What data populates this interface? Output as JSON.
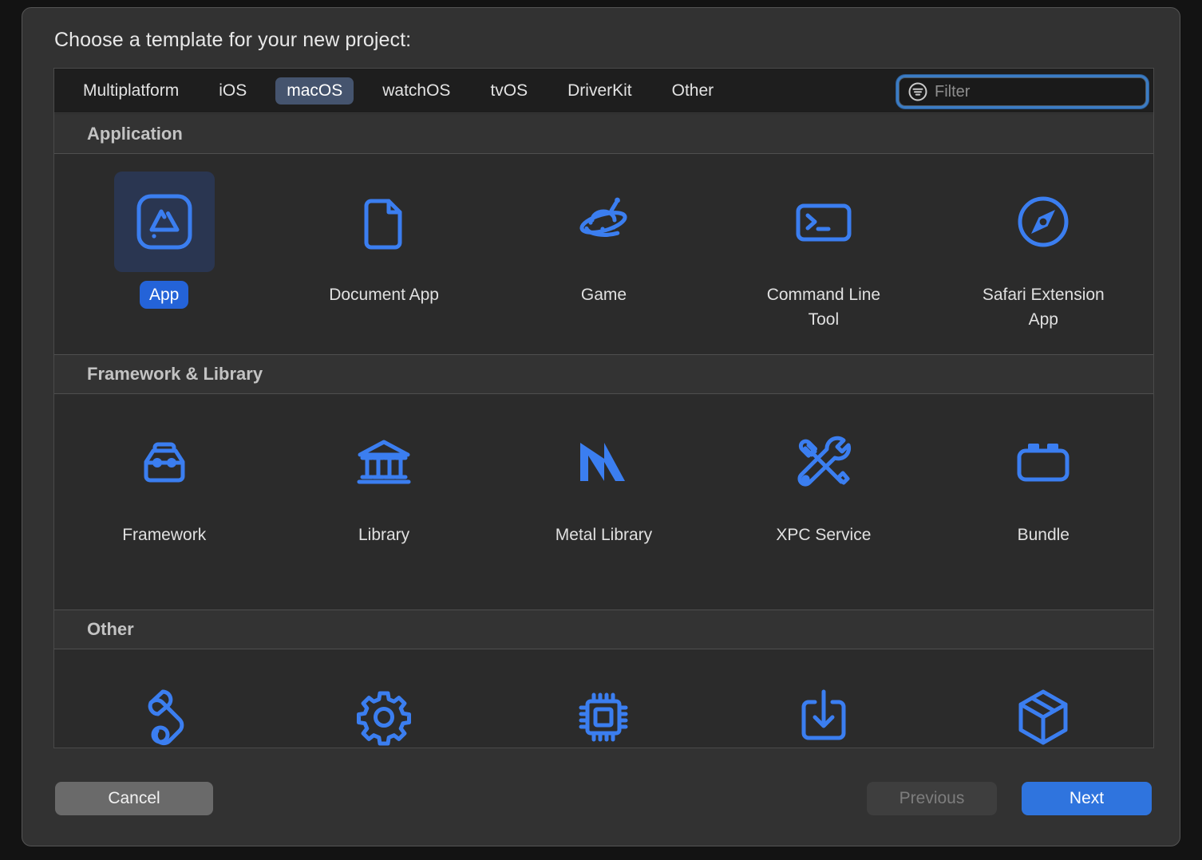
{
  "window": {
    "title": "Choose a template for your new project:"
  },
  "tabs": [
    {
      "label": "Multiplatform",
      "selected": false
    },
    {
      "label": "iOS",
      "selected": false
    },
    {
      "label": "macOS",
      "selected": true
    },
    {
      "label": "watchOS",
      "selected": false
    },
    {
      "label": "tvOS",
      "selected": false
    },
    {
      "label": "DriverKit",
      "selected": false
    },
    {
      "label": "Other",
      "selected": false
    }
  ],
  "filter": {
    "value": "",
    "placeholder": "Filter",
    "icon": "filter-icon",
    "focused": true
  },
  "sections": [
    {
      "title": "Application",
      "items": [
        {
          "label": "App",
          "icon": "app-store-icon",
          "selected": true
        },
        {
          "label": "Document App",
          "icon": "document-icon",
          "selected": false
        },
        {
          "label": "Game",
          "icon": "ufo-icon",
          "selected": false
        },
        {
          "label": "Command Line Tool",
          "icon": "terminal-icon",
          "selected": false
        },
        {
          "label": "Safari Extension App",
          "icon": "safari-compass-icon",
          "selected": false
        }
      ]
    },
    {
      "title": "Framework & Library",
      "items": [
        {
          "label": "Framework",
          "icon": "toolbox-icon",
          "selected": false
        },
        {
          "label": "Library",
          "icon": "classical-building-icon",
          "selected": false
        },
        {
          "label": "Metal Library",
          "icon": "metal-m-icon",
          "selected": false
        },
        {
          "label": "XPC Service",
          "icon": "tools-crossed-icon",
          "selected": false
        },
        {
          "label": "Bundle",
          "icon": "brick-bundle-icon",
          "selected": false
        }
      ]
    },
    {
      "title": "Other",
      "items": [
        {
          "label": "",
          "icon": "scroll-icon",
          "selected": false
        },
        {
          "label": "",
          "icon": "gear-icon",
          "selected": false
        },
        {
          "label": "",
          "icon": "chip-icon",
          "selected": false
        },
        {
          "label": "",
          "icon": "download-tray-icon",
          "selected": false
        },
        {
          "label": "",
          "icon": "package-cube-icon",
          "selected": false
        }
      ]
    }
  ],
  "footer": {
    "cancel_label": "Cancel",
    "previous_label": "Previous",
    "next_label": "Next",
    "previous_disabled": true
  },
  "colors": {
    "accent_blue": "#3b7ef0",
    "selection_blue": "#2463d8",
    "default_button_blue": "#2f74de",
    "tab_selected": "#45546e",
    "focus_ring": "#3b7cc4"
  }
}
